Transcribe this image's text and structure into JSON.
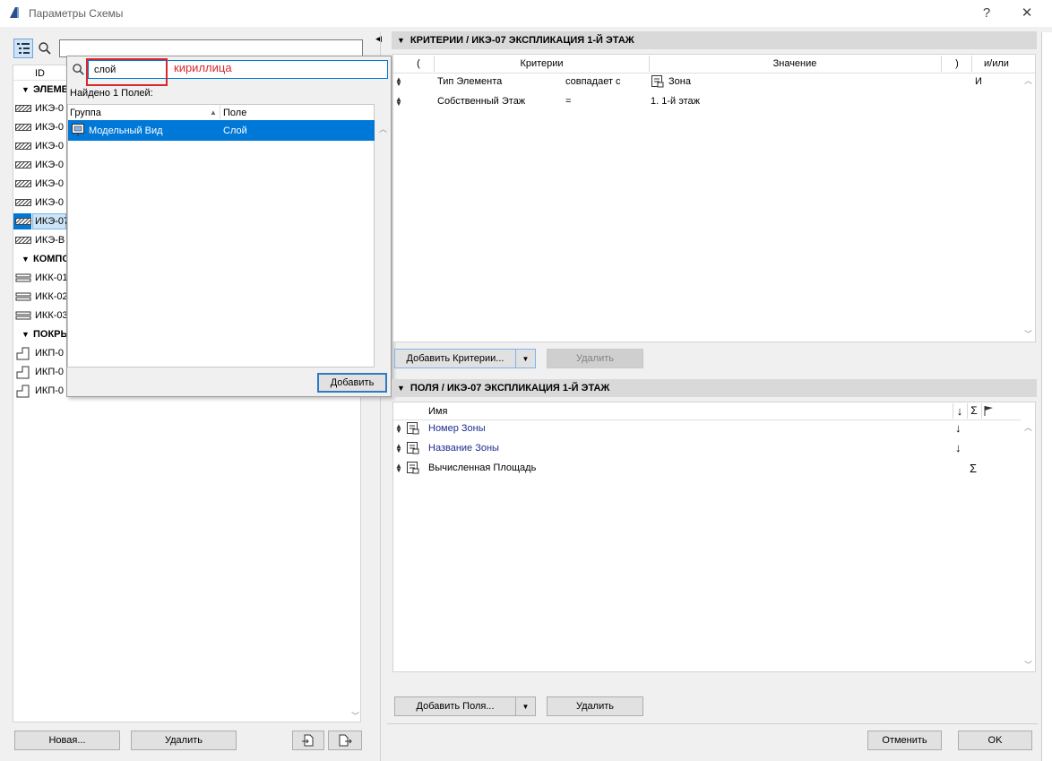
{
  "window": {
    "title": "Параметры Схемы",
    "help_label": "?",
    "close_label": "✕"
  },
  "left": {
    "id_header": "ID",
    "groups": [
      {
        "label": "ЭЛЕМЕ",
        "items": [
          "ИКЭ-0",
          "ИКЭ-0",
          "ИКЭ-0",
          "ИКЭ-0",
          "ИКЭ-0",
          "ИКЭ-0",
          "ИКЭ-07",
          "ИКЭ-В"
        ]
      },
      {
        "label": "КОМПО",
        "items": [
          "ИКК-01",
          "ИКК-02",
          "ИКК-03"
        ]
      },
      {
        "label": "ПОКРЫ",
        "items": [
          "ИКП-0",
          "ИКП-0",
          "ИКП-0"
        ]
      }
    ],
    "new_button": "Новая...",
    "delete_button": "Удалить"
  },
  "popup": {
    "search_value": "слой",
    "annotation": "кириллица",
    "found_text": "Найдено 1 Полей:",
    "col_group": "Группа",
    "col_field": "Поле",
    "row": {
      "group": "Модельный Вид",
      "field": "Слой"
    },
    "add_button": "Добавить"
  },
  "criteria": {
    "header": "КРИТЕРИИ / ИКЭ-07 ЭКСПЛИКАЦИЯ 1-Й ЭТАЖ",
    "col_open": "(",
    "col_criteria": "Критерии",
    "col_value": "Значение",
    "col_close": ")",
    "col_andor": "и/или",
    "rows": [
      {
        "name": "Тип Элемента",
        "op": "совпадает с",
        "value": "Зона",
        "andor": "И"
      },
      {
        "name": "Собственный Этаж",
        "op": "=",
        "value": "1. 1-й этаж",
        "andor": ""
      }
    ],
    "add_button": "Добавить Критерии...",
    "delete_button": "Удалить"
  },
  "fields": {
    "header": "ПОЛЯ / ИКЭ-07 ЭКСПЛИКАЦИЯ 1-Й ЭТАЖ",
    "col_name": "Имя",
    "col_sort": "↓",
    "col_sum": "Σ",
    "rows": [
      {
        "name": "Номер Зоны",
        "sort": "↓",
        "sum": ""
      },
      {
        "name": "Название Зоны",
        "sort": "↓",
        "sum": ""
      },
      {
        "name": "Вычисленная Площадь",
        "sort": "",
        "sum": "Σ"
      }
    ],
    "add_button": "Добавить Поля...",
    "delete_button": "Удалить"
  },
  "footer": {
    "cancel_button": "Отменить",
    "ok_button": "OK"
  },
  "colors": {
    "selection": "#0078d7",
    "link_text": "#1f2f8f",
    "annotation_red": "#d9262c"
  }
}
